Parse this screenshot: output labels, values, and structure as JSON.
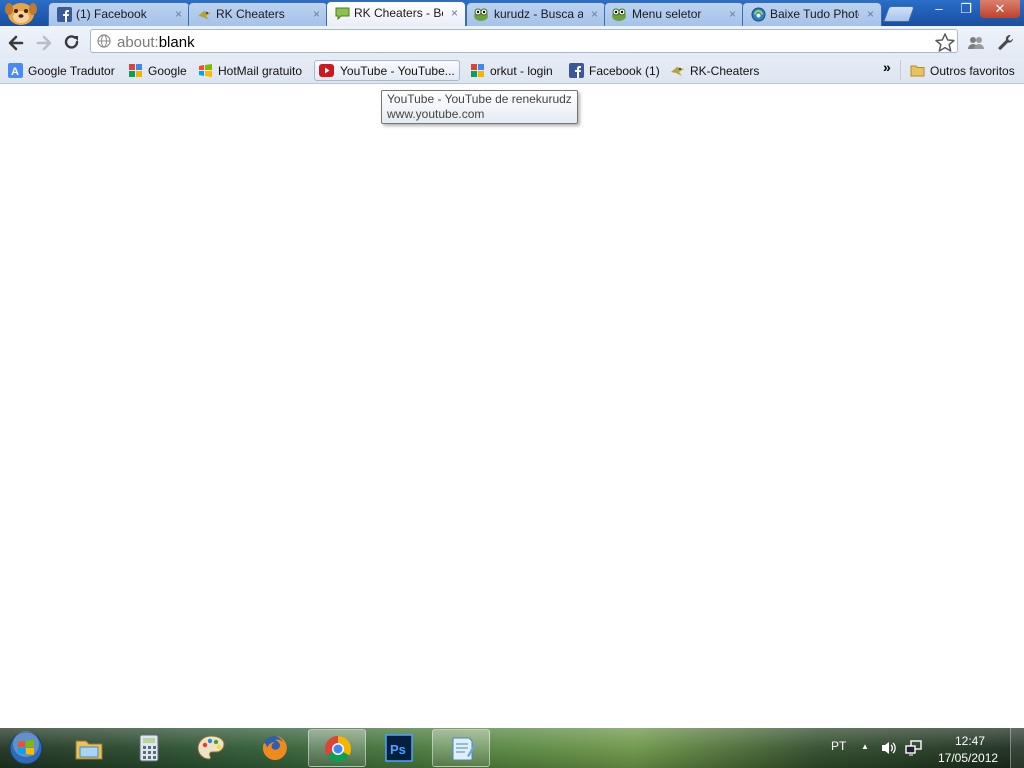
{
  "browser": {
    "tabs": [
      {
        "title": "(1) Facebook",
        "icon": "facebook-icon",
        "active": false
      },
      {
        "title": "RK Cheaters",
        "icon": "rk-cheaters-icon",
        "active": false
      },
      {
        "title": "RK Cheaters - Bem",
        "icon": "forum-speech-icon",
        "active": true
      },
      {
        "title": "kurudz - Busca avançada",
        "icon": "kurudz-icon",
        "active": false
      },
      {
        "title": "Menu seletor",
        "icon": "kurudz-icon",
        "active": false
      },
      {
        "title": "Baixe Tudo Photoshop",
        "icon": "baixe-tudo-icon",
        "active": false
      }
    ],
    "tab_close_glyph": "×",
    "window_controls": {
      "minimize": "–",
      "maximize": "❐",
      "close": "✕"
    },
    "omnibox": {
      "scheme": "about:",
      "path": "blank"
    },
    "bookmarks": [
      {
        "label": "Google Tradutor",
        "icon": "google-translate-icon"
      },
      {
        "label": "Google",
        "icon": "google-icon"
      },
      {
        "label": "HotMail gratuito",
        "icon": "windows-flag-icon"
      },
      {
        "label": "YouTube - YouTube...",
        "icon": "youtube-icon"
      },
      {
        "label": "orkut - login",
        "icon": "google-icon"
      },
      {
        "label": "Facebook (1)",
        "icon": "facebook-icon"
      },
      {
        "label": "RK-Cheaters",
        "icon": "rk-cheaters-icon"
      }
    ],
    "bookmarks_overflow": "»",
    "other_bookmarks": "Outros favoritos",
    "tooltip": {
      "title": "YouTube - YouTube de renekurudz",
      "url": "www.youtube.com"
    }
  },
  "taskbar": {
    "items": [
      {
        "name": "windows-explorer",
        "open": false
      },
      {
        "name": "calculator",
        "open": false
      },
      {
        "name": "paint",
        "open": false
      },
      {
        "name": "firefox",
        "open": false
      },
      {
        "name": "chrome",
        "open": true
      },
      {
        "name": "photoshop",
        "open": false
      },
      {
        "name": "notepad-app",
        "open": true
      }
    ],
    "language": "PT",
    "tray_arrow": "▲",
    "time": "12:47",
    "date": "17/05/2012"
  },
  "colors": {
    "accent": "#1d58ad",
    "tab_active": "#ffffff",
    "taskbar": "#2f5a35"
  }
}
